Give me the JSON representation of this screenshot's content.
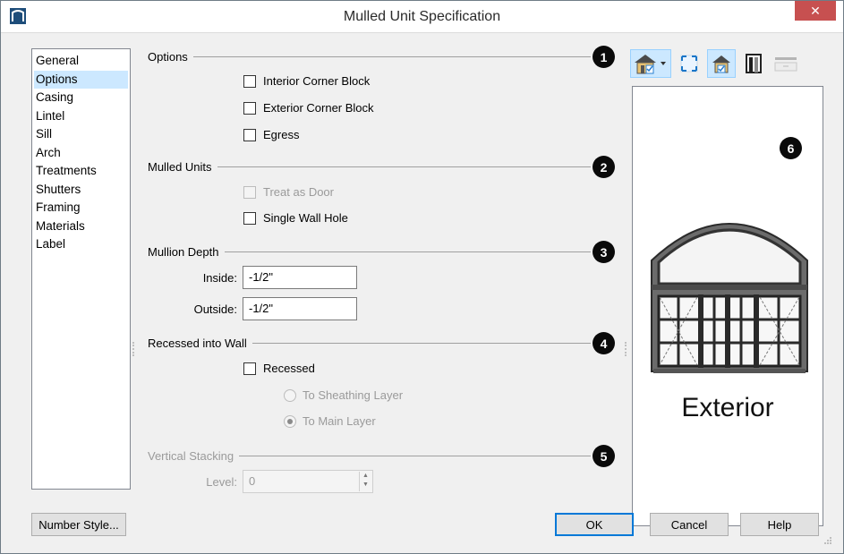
{
  "window": {
    "title": "Mulled Unit Specification",
    "close_label": "✕"
  },
  "nav": {
    "items": [
      {
        "label": "General",
        "selected": false
      },
      {
        "label": "Options",
        "selected": true
      },
      {
        "label": "Casing",
        "selected": false
      },
      {
        "label": "Lintel",
        "selected": false
      },
      {
        "label": "Sill",
        "selected": false
      },
      {
        "label": "Arch",
        "selected": false
      },
      {
        "label": "Treatments",
        "selected": false
      },
      {
        "label": "Shutters",
        "selected": false
      },
      {
        "label": "Framing",
        "selected": false
      },
      {
        "label": "Materials",
        "selected": false
      },
      {
        "label": "Label",
        "selected": false
      }
    ]
  },
  "sections": {
    "options": {
      "label": "Options",
      "badge": "1",
      "interior_corner_block": {
        "label": "Interior Corner Block",
        "checked": false
      },
      "exterior_corner_block": {
        "label": "Exterior Corner Block",
        "checked": false
      },
      "egress": {
        "label": "Egress",
        "checked": false
      }
    },
    "mulled_units": {
      "label": "Mulled Units",
      "badge": "2",
      "treat_as_door": {
        "label": "Treat as Door",
        "checked": false,
        "disabled": true
      },
      "single_wall_hole": {
        "label": "Single Wall Hole",
        "checked": false
      }
    },
    "mullion_depth": {
      "label": "Mullion Depth",
      "badge": "3",
      "inside_label": "Inside:",
      "inside_value": "-1/2\"",
      "outside_label": "Outside:",
      "outside_value": "-1/2\""
    },
    "recessed": {
      "label": "Recessed into Wall",
      "badge": "4",
      "recessed": {
        "label": "Recessed",
        "checked": false
      },
      "to_sheathing": {
        "label": "To Sheathing Layer",
        "selected": false,
        "disabled": true
      },
      "to_main": {
        "label": "To Main Layer",
        "selected": true,
        "disabled": true
      }
    },
    "vertical_stacking": {
      "label": "Vertical Stacking",
      "badge": "5",
      "disabled": true,
      "level_label": "Level:",
      "level_value": "0"
    }
  },
  "preview": {
    "badge": "6",
    "caption": "Exterior",
    "toolbar": [
      "view-type-dropdown-icon",
      "fill-window-icon",
      "show-exterior-icon",
      "door-frame-icon",
      "wall-preview-icon"
    ]
  },
  "buttons": {
    "number_style": "Number Style...",
    "ok": "OK",
    "cancel": "Cancel",
    "help": "Help"
  }
}
